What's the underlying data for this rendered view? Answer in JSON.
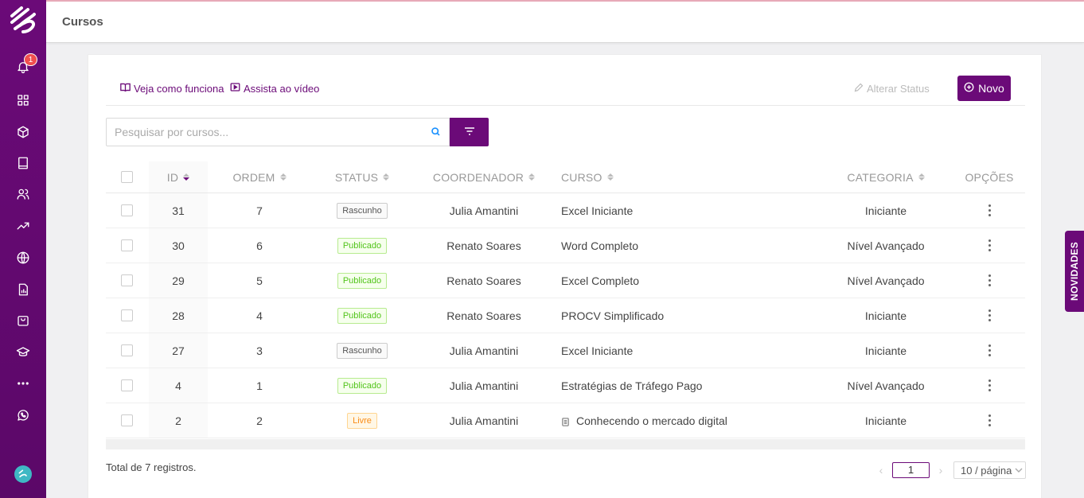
{
  "header": {
    "title": "Cursos"
  },
  "sidebar": {
    "notification_count": "1"
  },
  "toolbar": {
    "how_it_works": "Veja como funciona",
    "watch_video": "Assista ao vídeo",
    "change_status": "Alterar Status",
    "new_label": "Novo"
  },
  "search": {
    "placeholder": "Pesquisar por cursos..."
  },
  "table": {
    "columns": {
      "id": "ID",
      "ordem": "ORDEM",
      "status": "STATUS",
      "coordenador": "COORDENADOR",
      "curso": "CURSO",
      "categoria": "CATEGORIA",
      "opcoes": "OPÇÕES"
    },
    "rows": [
      {
        "id": "31",
        "ordem": "7",
        "status": "Rascunho",
        "status_type": "rascunho",
        "coordenador": "Julia Amantini",
        "curso": "Excel Iniciante",
        "categoria": "Iniciante"
      },
      {
        "id": "30",
        "ordem": "6",
        "status": "Publicado",
        "status_type": "publicado",
        "coordenador": "Renato Soares",
        "curso": "Word Completo",
        "categoria": "Nível Avançado"
      },
      {
        "id": "29",
        "ordem": "5",
        "status": "Publicado",
        "status_type": "publicado",
        "coordenador": "Renato Soares",
        "curso": "Excel Completo",
        "categoria": "Nível Avançado"
      },
      {
        "id": "28",
        "ordem": "4",
        "status": "Publicado",
        "status_type": "publicado",
        "coordenador": "Renato Soares",
        "curso": "PROCV Simplificado",
        "categoria": "Iniciante"
      },
      {
        "id": "27",
        "ordem": "3",
        "status": "Rascunho",
        "status_type": "rascunho",
        "coordenador": "Julia Amantini",
        "curso": "Excel Iniciante",
        "categoria": "Iniciante"
      },
      {
        "id": "4",
        "ordem": "1",
        "status": "Publicado",
        "status_type": "publicado",
        "coordenador": "Julia Amantini",
        "curso": "Estratégias de Tráfego Pago",
        "categoria": "Nível Avançado"
      },
      {
        "id": "2",
        "ordem": "2",
        "status": "Livre",
        "status_type": "livre",
        "coordenador": "Julia Amantini",
        "curso": "Conhecendo o mercado digital",
        "categoria": "Iniciante",
        "has_doc_icon": true
      }
    ]
  },
  "footer": {
    "total": "Total de 7 registros.",
    "current_page": "1",
    "page_size": "10 / página"
  },
  "novidades": "NOVIDADES"
}
